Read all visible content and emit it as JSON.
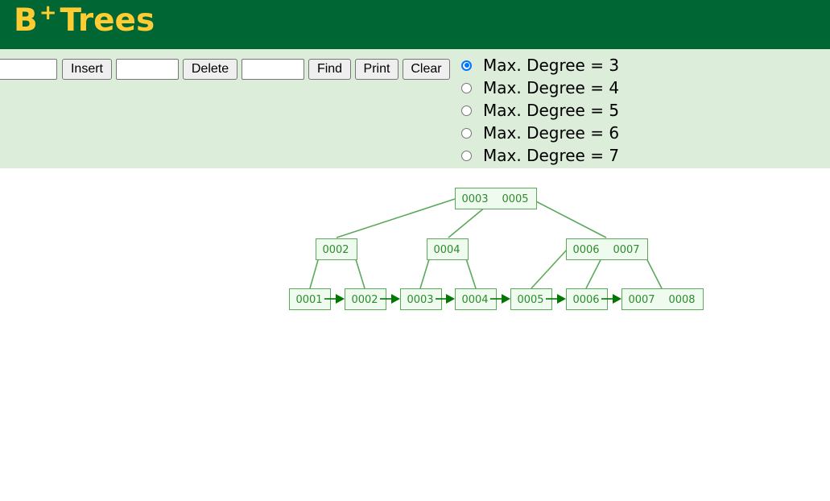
{
  "header": {
    "title_main": "B",
    "title_sup": "+",
    "title_rest": "Trees"
  },
  "controls": {
    "insert_value": "",
    "insert_label": "Insert",
    "delete_value": "",
    "delete_label": "Delete",
    "find_value": "",
    "find_label": "Find",
    "print_label": "Print",
    "clear_label": "Clear",
    "degree_options": [
      {
        "label": "Max. Degree = 3",
        "checked": true
      },
      {
        "label": "Max. Degree = 4",
        "checked": false
      },
      {
        "label": "Max. Degree = 5",
        "checked": false
      },
      {
        "label": "Max. Degree = 6",
        "checked": false
      },
      {
        "label": "Max. Degree = 7",
        "checked": false
      }
    ]
  },
  "tree": {
    "colors": {
      "stroke": "#5aaa5a",
      "fill": "#eefbee",
      "text": "#2e8b2e",
      "arrow": "#007700"
    },
    "levels": [
      [
        [
          "0003",
          "0005"
        ]
      ],
      [
        [
          "0002"
        ],
        [
          "0004"
        ],
        [
          "0006",
          "0007"
        ]
      ],
      [
        [
          "0001"
        ],
        [
          "0002"
        ],
        [
          "0003"
        ],
        [
          "0004"
        ],
        [
          "0005"
        ],
        [
          "0006"
        ],
        [
          "0007",
          "0008"
        ]
      ]
    ]
  }
}
